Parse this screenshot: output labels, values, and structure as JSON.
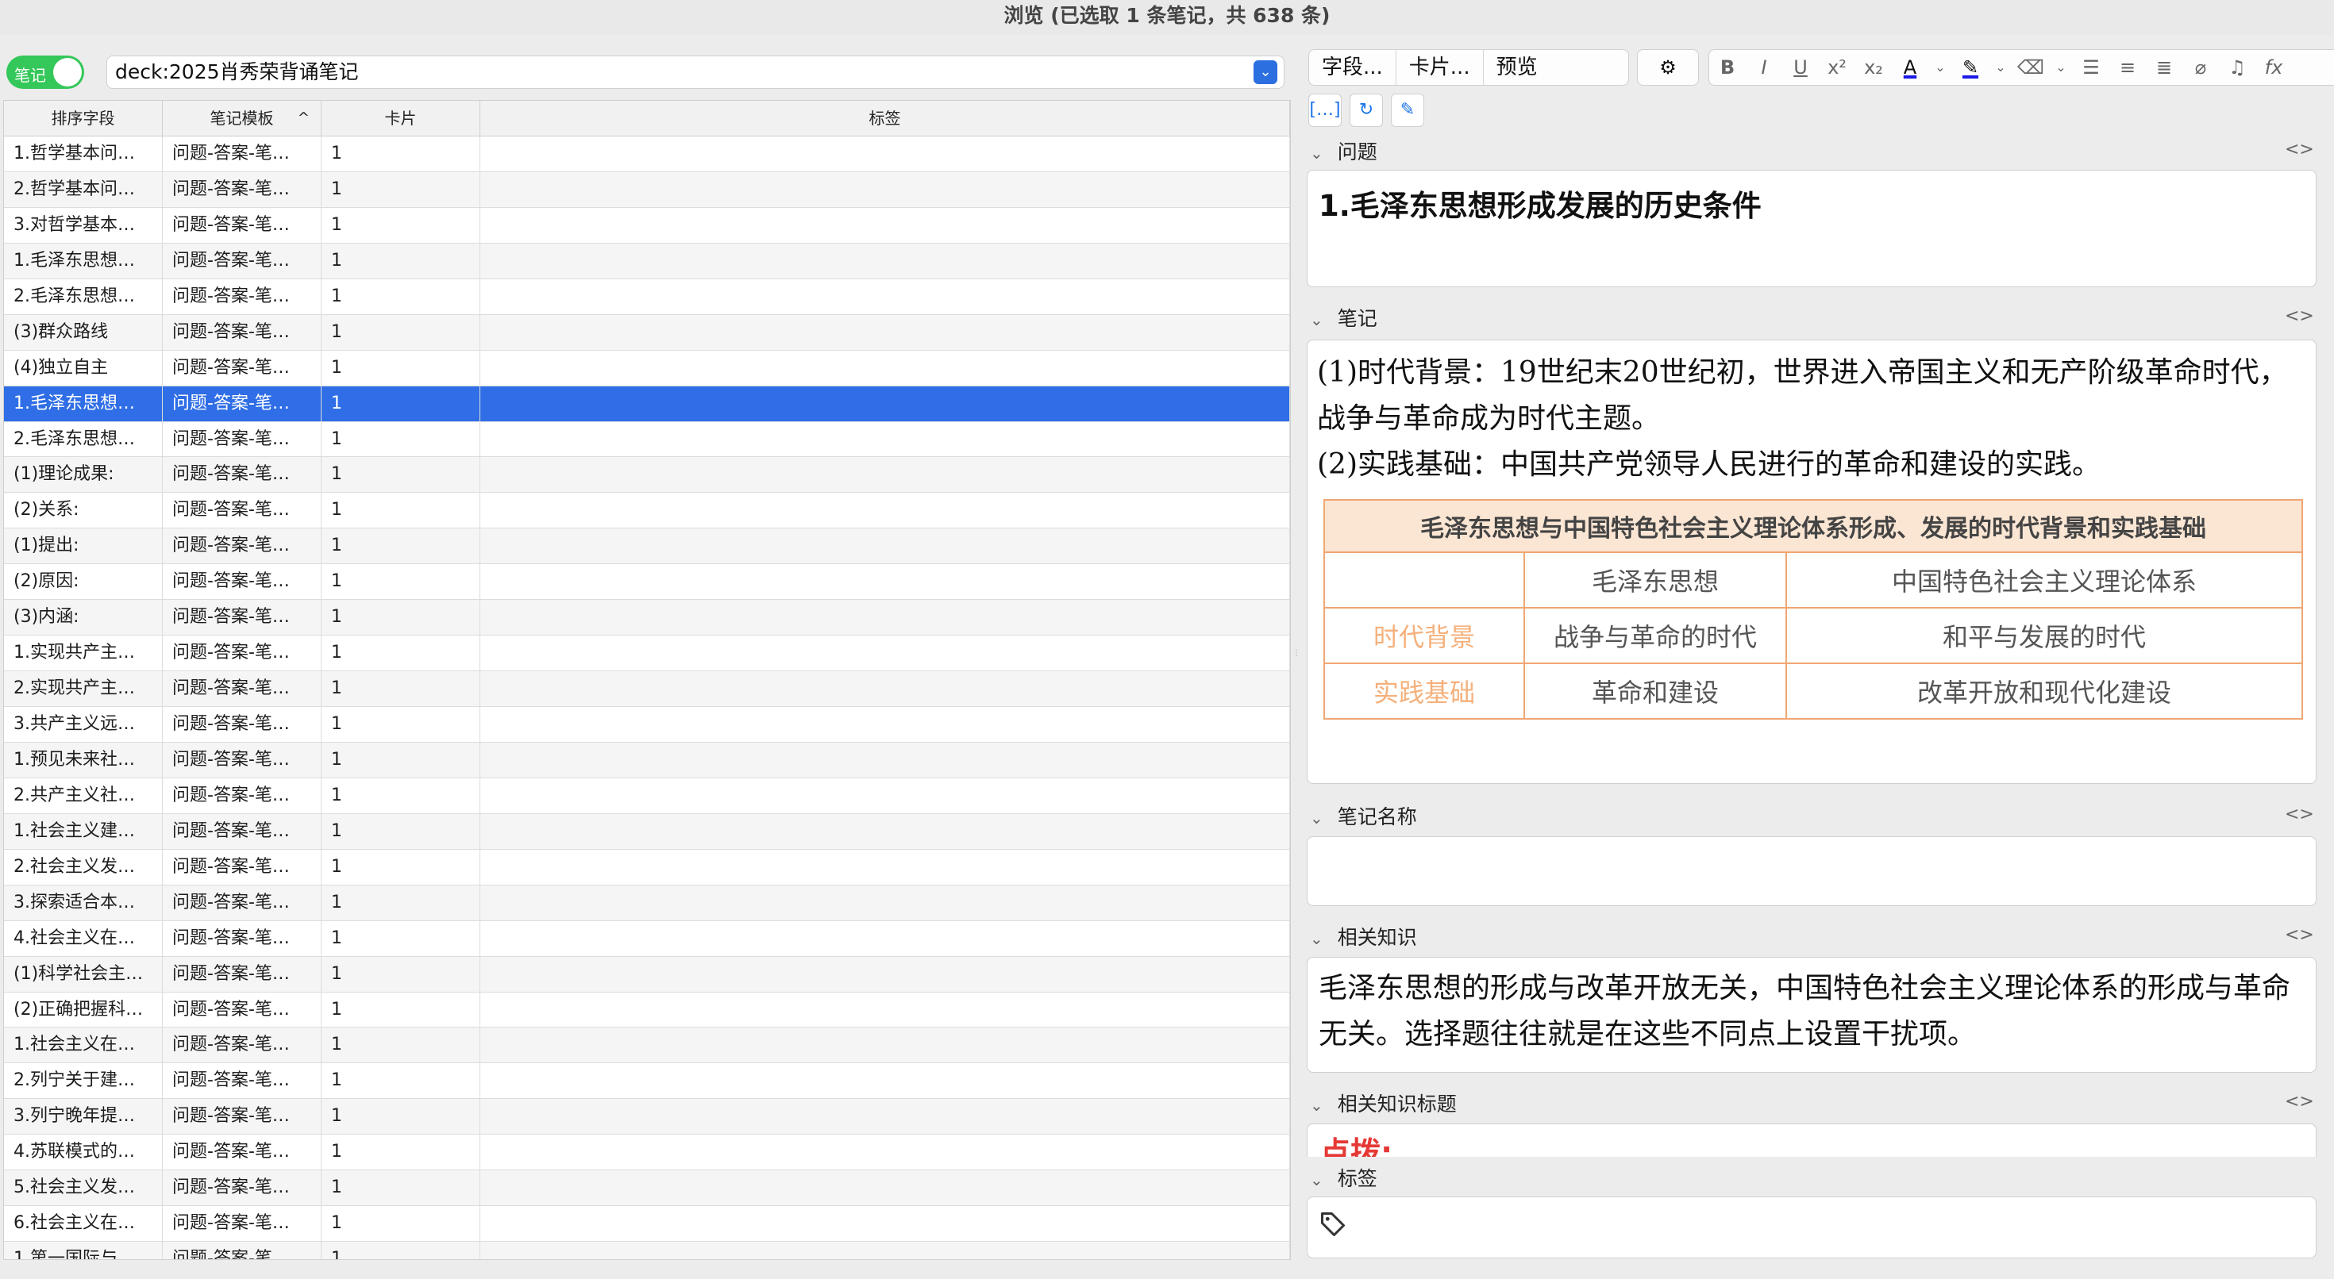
{
  "window": {
    "title": "浏览 (已选取 1 条笔记，共 638 条)"
  },
  "toggle": {
    "label": "笔记",
    "on": true
  },
  "search": {
    "value": "deck:2025肖秀荣背诵笔记"
  },
  "table": {
    "headers": [
      "排序字段",
      "笔记模板",
      "卡片",
      "标签"
    ],
    "rows": [
      {
        "sort": "1.哲学基本问…",
        "template": "问题-答案-笔…",
        "cards": "1",
        "tags": ""
      },
      {
        "sort": "2.哲学基本问…",
        "template": "问题-答案-笔…",
        "cards": "1",
        "tags": ""
      },
      {
        "sort": "3.对哲学基本…",
        "template": "问题-答案-笔…",
        "cards": "1",
        "tags": ""
      },
      {
        "sort": "1.毛泽东思想…",
        "template": "问题-答案-笔…",
        "cards": "1",
        "tags": ""
      },
      {
        "sort": "2.毛泽东思想…",
        "template": "问题-答案-笔…",
        "cards": "1",
        "tags": ""
      },
      {
        "sort": "(3)群众路线",
        "template": "问题-答案-笔…",
        "cards": "1",
        "tags": ""
      },
      {
        "sort": "(4)独立自主",
        "template": "问题-答案-笔…",
        "cards": "1",
        "tags": ""
      },
      {
        "sort": "1.毛泽东思想…",
        "template": "问题-答案-笔…",
        "cards": "1",
        "tags": "",
        "selected": true
      },
      {
        "sort": "2.毛泽东思想…",
        "template": "问题-答案-笔…",
        "cards": "1",
        "tags": ""
      },
      {
        "sort": "(1)理论成果:",
        "template": "问题-答案-笔…",
        "cards": "1",
        "tags": ""
      },
      {
        "sort": "(2)关系:",
        "template": "问题-答案-笔…",
        "cards": "1",
        "tags": ""
      },
      {
        "sort": "(1)提出:",
        "template": "问题-答案-笔…",
        "cards": "1",
        "tags": ""
      },
      {
        "sort": "(2)原因:",
        "template": "问题-答案-笔…",
        "cards": "1",
        "tags": ""
      },
      {
        "sort": "(3)内涵:",
        "template": "问题-答案-笔…",
        "cards": "1",
        "tags": ""
      },
      {
        "sort": "1.实现共产主…",
        "template": "问题-答案-笔…",
        "cards": "1",
        "tags": ""
      },
      {
        "sort": "2.实现共产主…",
        "template": "问题-答案-笔…",
        "cards": "1",
        "tags": ""
      },
      {
        "sort": "3.共产主义远…",
        "template": "问题-答案-笔…",
        "cards": "1",
        "tags": ""
      },
      {
        "sort": "1.预见未来社…",
        "template": "问题-答案-笔…",
        "cards": "1",
        "tags": ""
      },
      {
        "sort": "2.共产主义社…",
        "template": "问题-答案-笔…",
        "cards": "1",
        "tags": ""
      },
      {
        "sort": "1.社会主义建…",
        "template": "问题-答案-笔…",
        "cards": "1",
        "tags": ""
      },
      {
        "sort": "2.社会主义发…",
        "template": "问题-答案-笔…",
        "cards": "1",
        "tags": ""
      },
      {
        "sort": "3.探索适合本…",
        "template": "问题-答案-笔…",
        "cards": "1",
        "tags": ""
      },
      {
        "sort": "4.社会主义在…",
        "template": "问题-答案-笔…",
        "cards": "1",
        "tags": ""
      },
      {
        "sort": "(1)科学社会主…",
        "template": "问题-答案-笔…",
        "cards": "1",
        "tags": ""
      },
      {
        "sort": "(2)正确把握科…",
        "template": "问题-答案-笔…",
        "cards": "1",
        "tags": ""
      },
      {
        "sort": "1.社会主义在…",
        "template": "问题-答案-笔…",
        "cards": "1",
        "tags": ""
      },
      {
        "sort": "2.列宁关于建…",
        "template": "问题-答案-笔…",
        "cards": "1",
        "tags": ""
      },
      {
        "sort": "3.列宁晚年提…",
        "template": "问题-答案-笔…",
        "cards": "1",
        "tags": ""
      },
      {
        "sort": "4.苏联模式的…",
        "template": "问题-答案-笔…",
        "cards": "1",
        "tags": ""
      },
      {
        "sort": "5.社会主义发…",
        "template": "问题-答案-笔…",
        "cards": "1",
        "tags": ""
      },
      {
        "sort": "6.社会主义在…",
        "template": "问题-答案-笔…",
        "cards": "1",
        "tags": ""
      },
      {
        "sort": "1.第一国际与…",
        "template": "问题-答案-笔…",
        "cards": "1",
        "tags": ""
      }
    ]
  },
  "toolbar": {
    "fields_label": "字段...",
    "cards_label": "卡片...",
    "preview_label": "预览"
  },
  "editor": {
    "fields": {
      "question": {
        "label": "问题",
        "value": "1.毛泽东思想形成发展的历史条件"
      },
      "note": {
        "label": "笔记",
        "line1": "(1)时代背景：19世纪末20世纪初，世界进入帝国主义和无产阶级革命时代，战争与革命成为时代主题。",
        "line2": "(2)实践基础：中国共产党领导人民进行的革命和建设的实践。",
        "table": {
          "title": "毛泽东思想与中国特色社会主义理论体系形成、发展的时代背景和实践基础",
          "col_headers": [
            "",
            "毛泽东思想",
            "中国特色社会主义理论体系"
          ],
          "rows": [
            [
              "时代背景",
              "战争与革命的时代",
              "和平与发展的时代"
            ],
            [
              "实践基础",
              "革命和建设",
              "改革开放和现代化建设"
            ]
          ]
        }
      },
      "note_name": {
        "label": "笔记名称",
        "value": ""
      },
      "related": {
        "label": "相关知识",
        "value": "毛泽东思想的形成与改革开放无关，中国特色社会主义理论体系的形成与革命无关。选择题往往就是在这些不同点上设置干扰项。"
      },
      "related_title": {
        "label": "相关知识标题",
        "value": "点拨:"
      },
      "tags": {
        "label": "标签",
        "value": ""
      }
    }
  },
  "colors": {
    "selection": "#2f6ee6",
    "toggle": "#34c759",
    "table_border": "#f0a672",
    "hint": "#e53935"
  }
}
